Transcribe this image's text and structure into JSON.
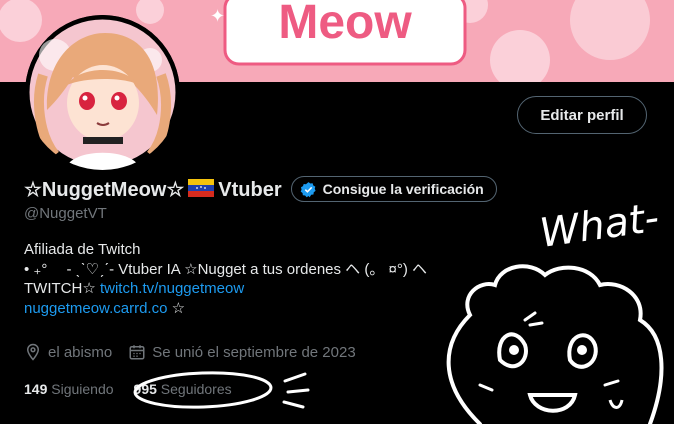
{
  "banner": {
    "text": "Meow"
  },
  "header": {
    "edit_profile_label": "Editar perfil"
  },
  "profile": {
    "display_name_part1": "☆NuggetMeow☆",
    "display_name_part2": "Vtuber",
    "verify_label": "Consigue la verificación",
    "handle": "@NuggetVT",
    "bio_line1": "Afiliada de Twitch",
    "bio_line2": "• ₊°　 - ˎˋ♡ˏˊ- Vtuber IA ☆Nugget a tus ordenes ヘ (。 ¤°) ヘ",
    "bio_line3_prefix": "TWITCH☆ ",
    "bio_line3_link": "twitch.tv/nuggetmeow",
    "bio_line4_link": "nuggetmeow.carrd.co",
    "bio_line4_suffix": " ☆",
    "location": "el abismo",
    "joined": "Se unió el septiembre de 2023",
    "following_count": "149",
    "following_label": "Siguiendo",
    "followers_count": "995",
    "followers_label": "Seguidores"
  },
  "doodle": {
    "text": "What-"
  },
  "colors": {
    "accent": "#1d9bf0",
    "banner_pink": "#f7a9b8",
    "banner_text": "#ee5b82"
  },
  "icons": [
    "location-icon",
    "calendar-icon",
    "verified-badge-icon"
  ]
}
